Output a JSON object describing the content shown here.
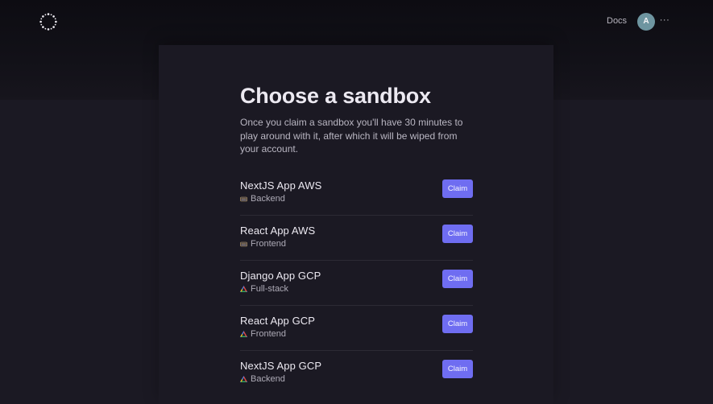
{
  "header": {
    "docs_label": "Docs",
    "avatar_initial": "A",
    "more_label": "···"
  },
  "main": {
    "title": "Choose a sandbox",
    "description": "Once you claim a sandbox you'll have 30 minutes to play around with it, after which it will be wiped from your account."
  },
  "sandboxes": [
    {
      "name": "NextJS App AWS",
      "type": "Backend",
      "provider_icon": "aws-icon",
      "claim_label": "Claim"
    },
    {
      "name": "React App AWS",
      "type": "Frontend",
      "provider_icon": "aws-icon",
      "claim_label": "Claim"
    },
    {
      "name": "Django App GCP",
      "type": "Full-stack",
      "provider_icon": "gcp-icon",
      "claim_label": "Claim"
    },
    {
      "name": "React App GCP",
      "type": "Frontend",
      "provider_icon": "gcp-icon",
      "claim_label": "Claim"
    },
    {
      "name": "NextJS App GCP",
      "type": "Backend",
      "provider_icon": "gcp-icon",
      "claim_label": "Claim"
    }
  ],
  "colors": {
    "accent": "#6f6df1",
    "background": "#1b1923",
    "avatar": "#6e95a0"
  }
}
